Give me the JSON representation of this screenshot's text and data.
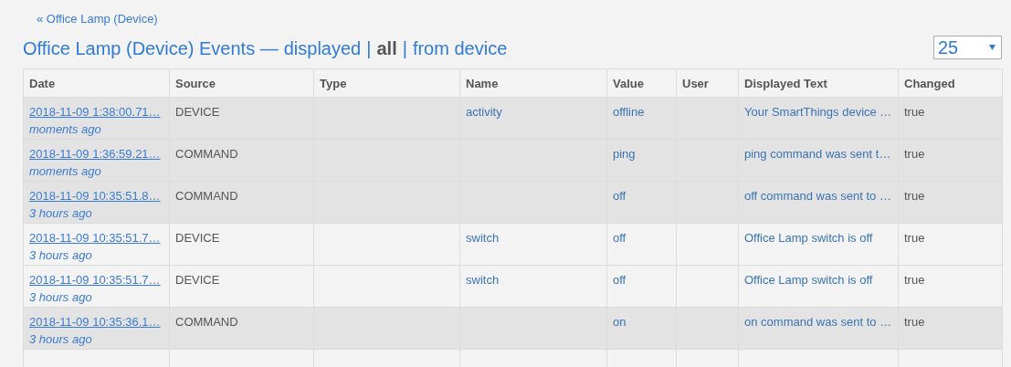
{
  "back_link": "« Office Lamp (Device)",
  "heading": {
    "title": "Office Lamp (Device) Events —",
    "filters": [
      {
        "label": "displayed",
        "selected": false
      },
      {
        "label": "all",
        "selected": true
      },
      {
        "label": "from device",
        "selected": false
      }
    ],
    "separators": [
      "|",
      "|"
    ]
  },
  "page_size": {
    "value": "25"
  },
  "table": {
    "columns": [
      "Date",
      "Source",
      "Type",
      "Name",
      "Value",
      "User",
      "Displayed Text",
      "Changed"
    ],
    "rows": [
      {
        "date": "2018-11-09 1:38:00.71…",
        "ago": "moments ago",
        "source": "DEVICE",
        "name": "activity",
        "value": "offline",
        "text": "Your SmartThings device …",
        "changed": "true",
        "highlighted": true
      },
      {
        "date": "2018-11-09 1:36:59.21…",
        "ago": "moments ago",
        "source": "COMMAND",
        "value": "ping",
        "text": "ping command was sent t…",
        "changed": "true",
        "highlighted": true
      },
      {
        "date": "2018-11-09 10:35:51.8…",
        "ago": "3 hours ago",
        "source": "COMMAND",
        "value": "off",
        "text": "off command was sent to …",
        "changed": "true",
        "highlighted": true
      },
      {
        "date": "2018-11-09 10:35:51.7…",
        "ago": "3 hours ago",
        "source": "DEVICE",
        "name": "switch",
        "value": "off",
        "text": "Office Lamp switch is off",
        "changed": "true",
        "highlighted": false
      },
      {
        "date": "2018-11-09 10:35:51.7…",
        "ago": "3 hours ago",
        "source": "DEVICE",
        "name": "switch",
        "value": "off",
        "text": "Office Lamp switch is off",
        "changed": "true",
        "highlighted": false
      },
      {
        "date": "2018-11-09 10:35:36.1…",
        "ago": "3 hours ago",
        "source": "COMMAND",
        "value": "on",
        "text": "on command was sent to …",
        "changed": "true",
        "highlighted": true
      }
    ]
  }
}
